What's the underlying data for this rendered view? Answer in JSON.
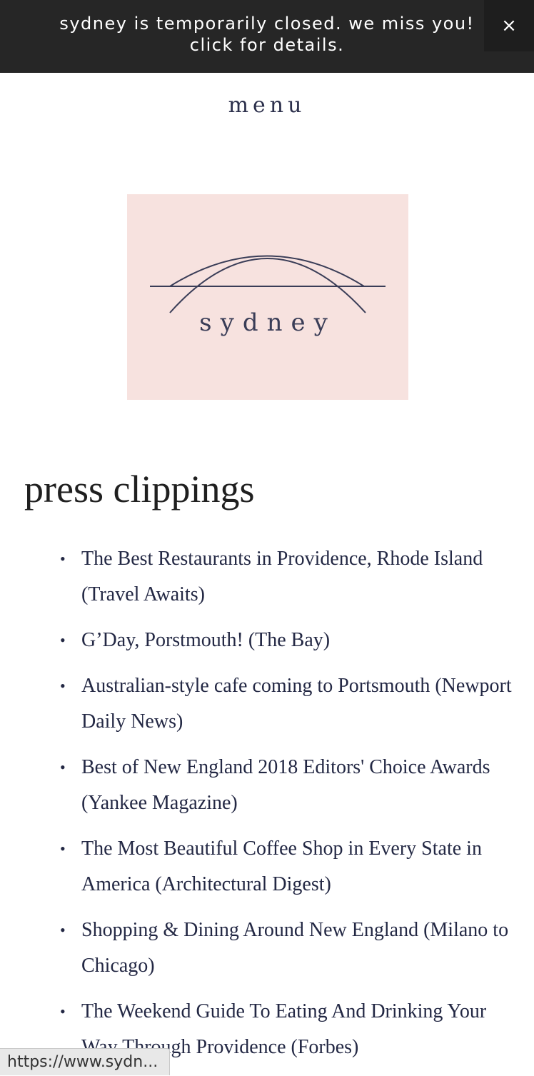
{
  "banner": {
    "line1": "sydney is temporarily closed. we miss you!",
    "line2": "click for details.",
    "close_label": "×"
  },
  "nav": {
    "menu_label": "menu"
  },
  "logo": {
    "wordmark": "sydney",
    "background_color": "#f7e2df",
    "ink_color": "#3a3d57"
  },
  "main": {
    "title": "press clippings",
    "bullet": "•",
    "clippings": [
      "The Best Restaurants in Providence, Rhode Island (Travel Awaits)",
      "G’Day, Porstmouth! (The Bay)",
      "Australian-style cafe coming to Portsmouth (Newport Daily News)",
      "Best of New England 2018 Editors' Choice Awards (Yankee Magazine)",
      "The Most Beautiful Coffee Shop in Every State in America (Architectural Digest)",
      "Shopping & Dining Around New England (Milano to Chicago)",
      "The Weekend Guide To Eating And Drinking Your Way Through Providence (Forbes)"
    ]
  },
  "status_bar": {
    "url": "https://www.sydn..."
  },
  "colors": {
    "banner_bg": "#262626",
    "text_navy": "#232844"
  }
}
